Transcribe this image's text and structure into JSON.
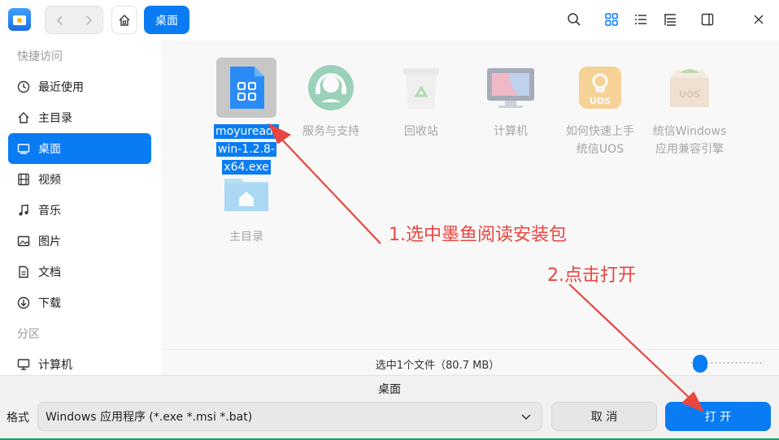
{
  "toolbar": {
    "back_icon": "chevron-left-icon",
    "forward_icon": "chevron-right-icon",
    "home_icon": "home-icon",
    "breadcrumb": "桌面"
  },
  "sidebar": {
    "section_quick": "快捷访问",
    "items": [
      {
        "label": "最近使用",
        "icon": "clock-icon"
      },
      {
        "label": "主目录",
        "icon": "home-icon"
      },
      {
        "label": "桌面",
        "icon": "desktop-icon",
        "active": true
      },
      {
        "label": "视频",
        "icon": "video-icon"
      },
      {
        "label": "音乐",
        "icon": "music-icon"
      },
      {
        "label": "图片",
        "icon": "image-icon"
      },
      {
        "label": "文档",
        "icon": "document-icon"
      },
      {
        "label": "下载",
        "icon": "download-icon"
      }
    ],
    "section_partition": "分区",
    "partition_items": [
      {
        "label": "计算机",
        "icon": "computer-icon"
      }
    ]
  },
  "files": [
    {
      "label": "moyureader-win-1.2.8-x64.exe",
      "label_lines": [
        "moyuread-",
        "win-1.2.8-",
        "x64.exe"
      ],
      "selected": true
    },
    {
      "label_lines": [
        "服务与支持"
      ]
    },
    {
      "label_lines": [
        "回收站"
      ]
    },
    {
      "label_lines": [
        "计算机"
      ]
    },
    {
      "label_lines": [
        "如何快速上手",
        "统信UOS"
      ]
    },
    {
      "label_lines": [
        "统信Windows",
        "应用兼容引擎"
      ]
    },
    {
      "label_lines": [
        "主目录"
      ]
    }
  ],
  "status": {
    "text": "选中1个文件（80.7 MB）",
    "zoom_level": 0.05
  },
  "bottom": {
    "folder_name": "桌面",
    "format_label": "格式",
    "format_value": "Windows 应用程序 (*.exe *.msi *.bat)",
    "cancel_label": "取 消",
    "open_label": "打 开"
  },
  "annotations": {
    "step1": "1.选中墨鱼阅读安装包",
    "step2": "2.点击打开",
    "color": "#e8463f"
  },
  "colors": {
    "accent": "#0a7cf3",
    "annotation": "#e8463f"
  }
}
